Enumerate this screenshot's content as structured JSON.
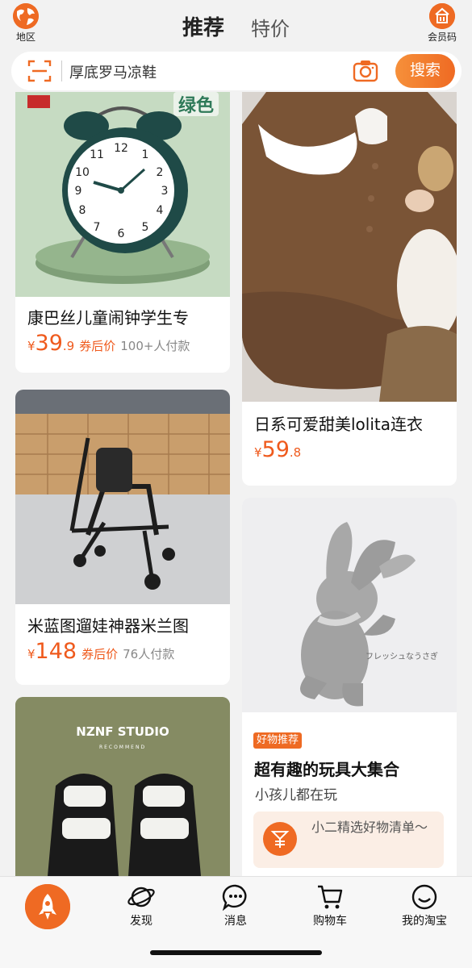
{
  "header": {
    "region_label": "地区",
    "tabs": [
      {
        "label": "推荐",
        "active": true
      },
      {
        "label": "特价",
        "active": false
      }
    ],
    "member_label": "会员码"
  },
  "search": {
    "query": "厚底罗马凉鞋",
    "button_label": "搜索"
  },
  "feed": {
    "left": [
      {
        "image_text": "绿色",
        "title": "康巴丝儿童闹钟学生专",
        "price_symbol": "¥",
        "price_int": "39",
        "price_dec": ".9",
        "coupon": "券后价",
        "sales": "100+人付款"
      },
      {
        "title": "米蓝图遛娃神器米兰图",
        "price_symbol": "¥",
        "price_int": "148",
        "coupon": "券后价",
        "sales": "76人付款"
      },
      {
        "image_brand": "NZNF STUDIO",
        "image_sub": "RECOMMEND"
      }
    ],
    "right": [
      {
        "title": "日系可爱甜美lolita连衣",
        "price_symbol": "¥",
        "price_int": "59",
        "price_dec": ".8"
      },
      {
        "image_caption": "フレッシュなうさぎ",
        "tag": "好物推荐",
        "title": "超有趣的玩具大集合",
        "subtitle": "小孩儿都在玩",
        "promo": "小二精选好物清单～"
      }
    ]
  },
  "nav": {
    "items": [
      {
        "label": "发现"
      },
      {
        "label": "消息"
      },
      {
        "label": "购物车"
      },
      {
        "label": "我的淘宝"
      }
    ]
  },
  "colors": {
    "accent": "#ef6a23",
    "price": "#ef5a1d",
    "background": "#f2f2f2"
  }
}
